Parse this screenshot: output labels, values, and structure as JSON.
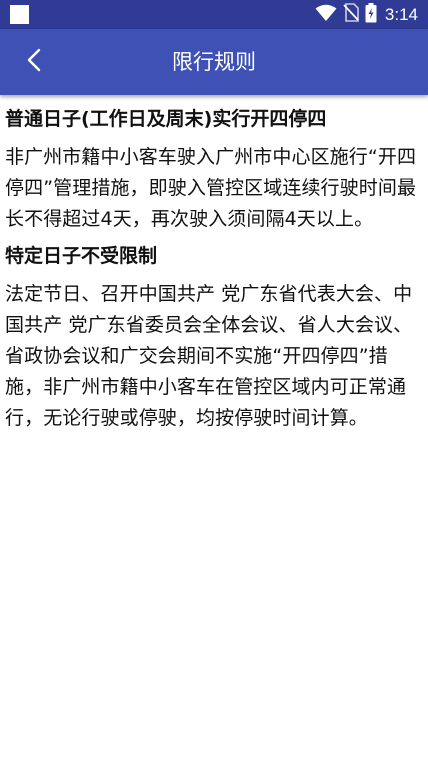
{
  "status_bar": {
    "time": "3:14",
    "icons": [
      "notification-square-icon",
      "wifi-icon",
      "no-sim-icon",
      "battery-charging-icon"
    ]
  },
  "header": {
    "title": "限行规则",
    "back_icon": "chevron-left-icon"
  },
  "content": {
    "sections": [
      {
        "title": "普通日子(工作日及周末)实行开四停四",
        "body": "非广州市籍中小客车驶入广州市中心区施行“开四停四”管理措施，即驶入管控区域连续行驶时间最长不得超过4天，再次驶入须间隔4天以上。"
      },
      {
        "title": "特定日子不受限制",
        "body": "法定节日、召开中国共产 党广东省代表大会、中国共产 党广东省委员会全体会议、省人大会议、省政协会议和广交会期间不实施“开四停四”措施，非广州市籍中小客车在管控区域内可正常通行，无论行驶或停驶，均按停驶时间计算。"
      }
    ]
  },
  "colors": {
    "status_bar": "#2f3b95",
    "app_bar": "#3f51b5",
    "text": "#111111",
    "background": "#ffffff"
  }
}
